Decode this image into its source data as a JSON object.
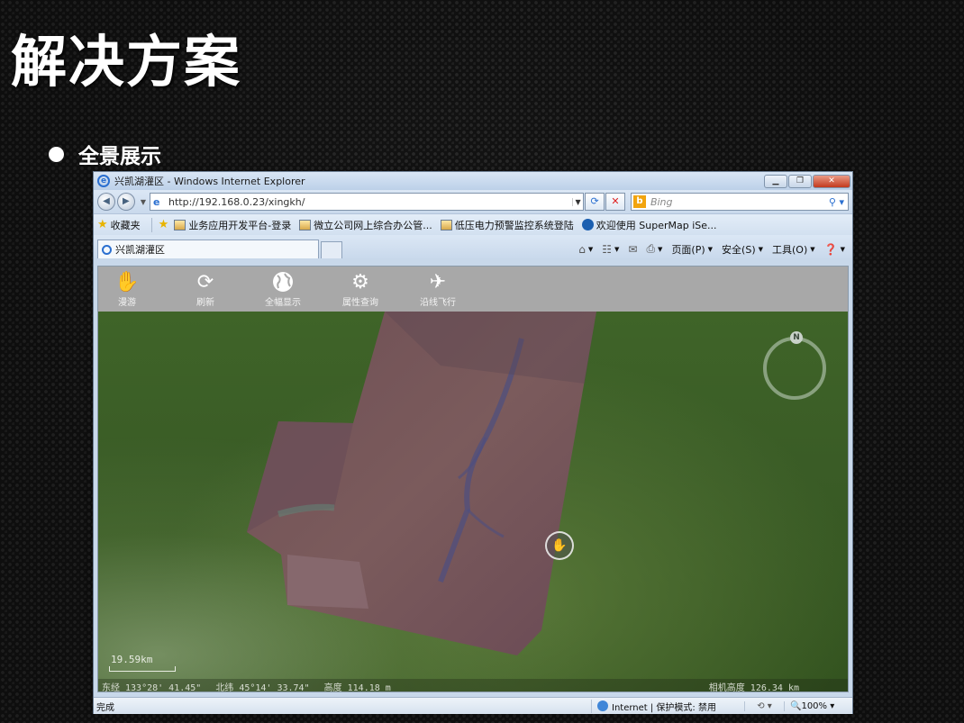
{
  "slide": {
    "title": "解决方案",
    "bullet": "全景展示"
  },
  "browser": {
    "window_title": "兴凯湖灌区 - Windows Internet Explorer",
    "address_url": "http://192.168.0.23/xingkh/",
    "search_placeholder": "Bing",
    "favorites_label": "收藏夹",
    "favorites": [
      "业务应用开发平台-登录",
      "微立公司网上综合办公管...",
      "低压电力预警监控系统登陆",
      "欢迎使用 SuperMap iSe..."
    ],
    "tab_title": "兴凯湖灌区",
    "commands": {
      "page": "页面(P)",
      "safety": "安全(S)",
      "tools": "工具(O)"
    },
    "status": {
      "done": "完成",
      "zone": "Internet | 保护模式: 禁用",
      "zoom": "100%"
    }
  },
  "app": {
    "tools": [
      {
        "label": "漫游",
        "icon": "hand-icon"
      },
      {
        "label": "刷新",
        "icon": "refresh-icon"
      },
      {
        "label": "全幅显示",
        "icon": "globe-icon"
      },
      {
        "label": "属性查询",
        "icon": "gear-icon"
      },
      {
        "label": "沿线飞行",
        "icon": "airplane-icon"
      }
    ],
    "compass_label": "N",
    "scale": "19.59km",
    "longitude": "东经 133°28' 41.45\"",
    "latitude": "北纬 45°14' 33.74\"",
    "elevation": "高度 114.18 m",
    "camera_altitude": "相机高度 126.34 km"
  },
  "colors": {
    "toolbar_bg": "#a8a8a8",
    "terrain_green": "#3a5c26",
    "image_overlay": "#7a5a5c"
  }
}
